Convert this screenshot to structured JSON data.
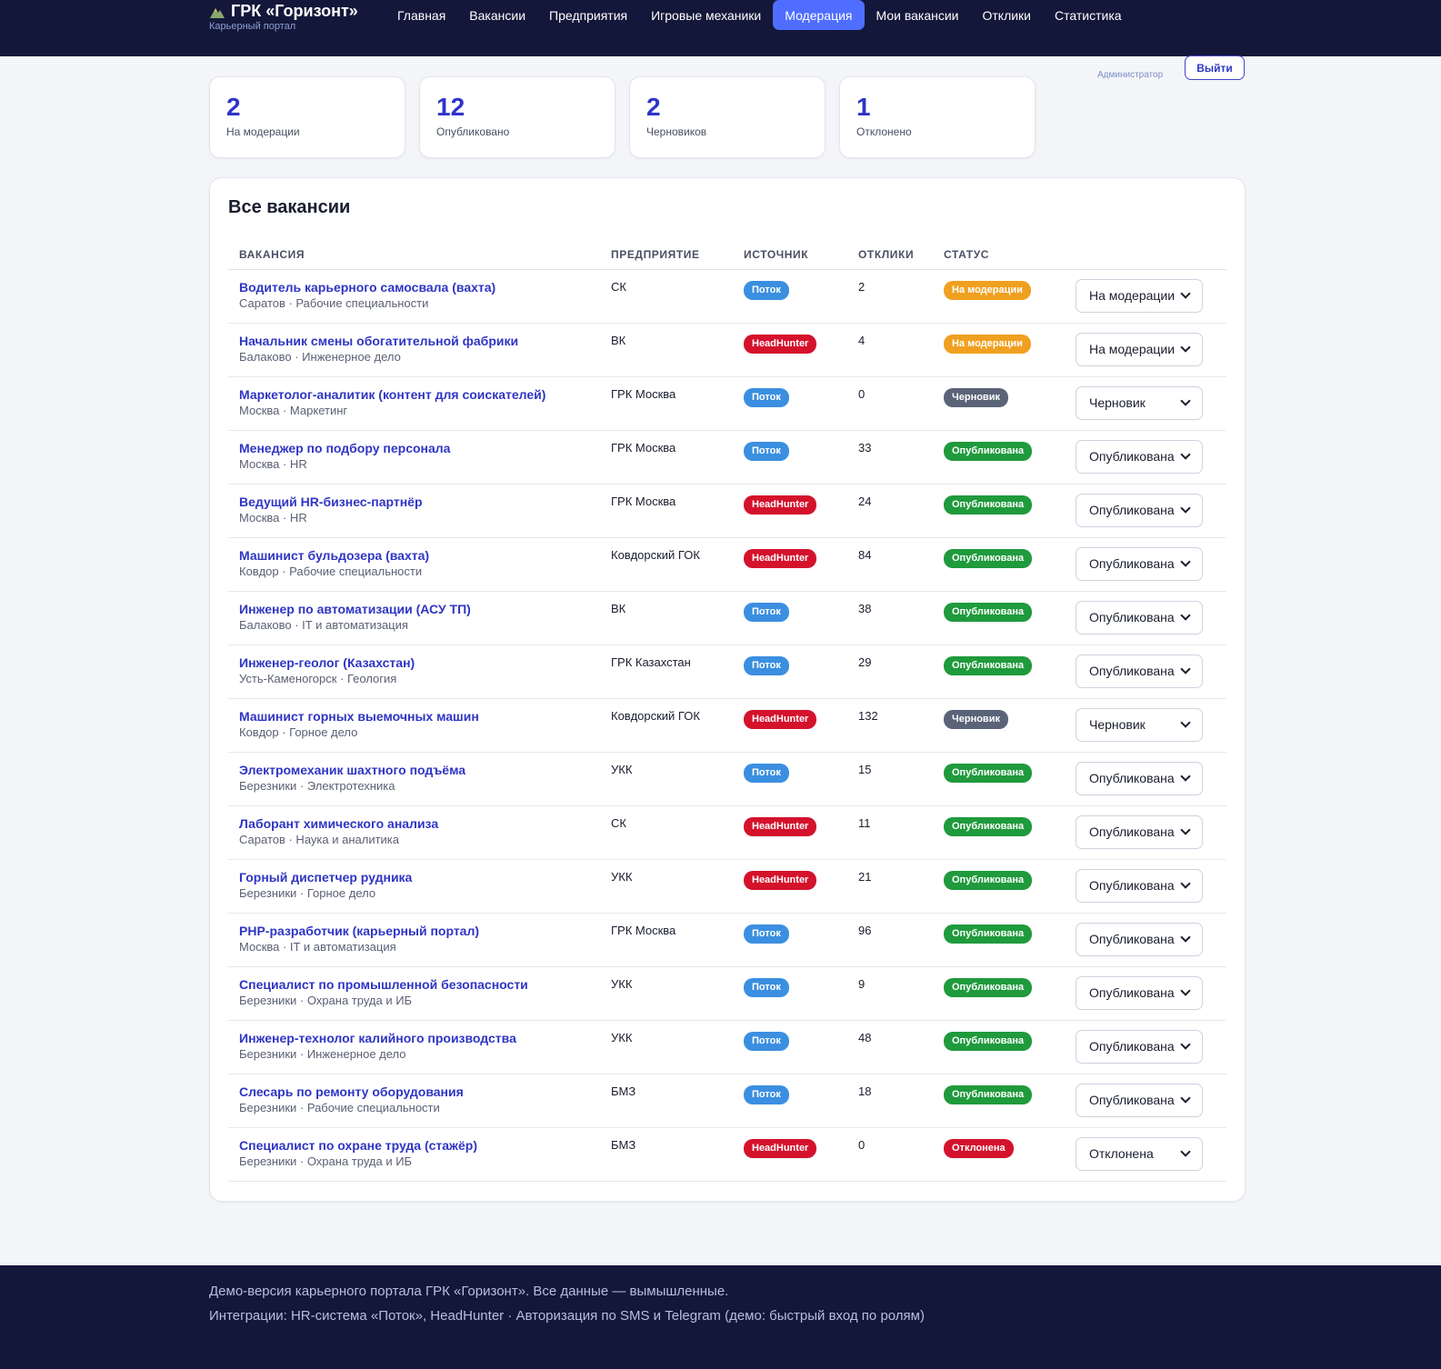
{
  "header": {
    "brand_title": "ГРК «Горизонт»",
    "brand_subtitle": "Карьерный портал",
    "nav": [
      {
        "label": "Главная",
        "active": false
      },
      {
        "label": "Вакансии",
        "active": false
      },
      {
        "label": "Предприятия",
        "active": false
      },
      {
        "label": "Игровые механики",
        "active": false
      },
      {
        "label": "Модерация",
        "active": true
      },
      {
        "label": "Мои вакансии",
        "active": false
      },
      {
        "label": "Отклики",
        "active": false
      },
      {
        "label": "Статистика",
        "active": false
      }
    ],
    "user_role": "Администратор",
    "logout_label": "Выйти"
  },
  "stats": [
    {
      "value": "2",
      "label": "На модерации"
    },
    {
      "value": "12",
      "label": "Опубликовано"
    },
    {
      "value": "2",
      "label": "Черновиков"
    },
    {
      "value": "1",
      "label": "Отклонено"
    }
  ],
  "table": {
    "title": "Все вакансии",
    "columns": [
      "ВАКАНСИЯ",
      "ПРЕДПРИЯТИЕ",
      "ИСТОЧНИК",
      "ОТКЛИКИ",
      "СТАТУС"
    ],
    "rows": [
      {
        "title": "Водитель карьерного самосвала (вахта)",
        "meta": "Саратов · Рабочие специальности",
        "enterprise": "СК",
        "source": "Поток",
        "responses": "2",
        "status": "На модерации",
        "select": "На модерации"
      },
      {
        "title": "Начальник смены обогатительной фабрики",
        "meta": "Балаково · Инженерное дело",
        "enterprise": "ВК",
        "source": "HeadHunter",
        "responses": "4",
        "status": "На модерации",
        "select": "На модерации"
      },
      {
        "title": "Маркетолог-аналитик (контент для соискателей)",
        "meta": "Москва · Маркетинг",
        "enterprise": "ГРК Москва",
        "source": "Поток",
        "responses": "0",
        "status": "Черновик",
        "select": "Черновик"
      },
      {
        "title": "Менеджер по подбору персонала",
        "meta": "Москва · HR",
        "enterprise": "ГРК Москва",
        "source": "Поток",
        "responses": "33",
        "status": "Опубликована",
        "select": "Опубликована"
      },
      {
        "title": "Ведущий HR-бизнес-партнёр",
        "meta": "Москва · HR",
        "enterprise": "ГРК Москва",
        "source": "HeadHunter",
        "responses": "24",
        "status": "Опубликована",
        "select": "Опубликована"
      },
      {
        "title": "Машинист бульдозера (вахта)",
        "meta": "Ковдор · Рабочие специальности",
        "enterprise": "Ковдорский ГОК",
        "source": "HeadHunter",
        "responses": "84",
        "status": "Опубликована",
        "select": "Опубликована"
      },
      {
        "title": "Инженер по автоматизации (АСУ ТП)",
        "meta": "Балаково · IT и автоматизация",
        "enterprise": "ВК",
        "source": "Поток",
        "responses": "38",
        "status": "Опубликована",
        "select": "Опубликована"
      },
      {
        "title": "Инженер-геолог (Казахстан)",
        "meta": "Усть-Каменогорск · Геология",
        "enterprise": "ГРК Казахстан",
        "source": "Поток",
        "responses": "29",
        "status": "Опубликована",
        "select": "Опубликована"
      },
      {
        "title": "Машинист горных выемочных машин",
        "meta": "Ковдор · Горное дело",
        "enterprise": "Ковдорский ГОК",
        "source": "HeadHunter",
        "responses": "132",
        "status": "Черновик",
        "select": "Черновик"
      },
      {
        "title": "Электромеханик шахтного подъёма",
        "meta": "Березники · Электротехника",
        "enterprise": "УКК",
        "source": "Поток",
        "responses": "15",
        "status": "Опубликована",
        "select": "Опубликована"
      },
      {
        "title": "Лаборант химического анализа",
        "meta": "Саратов · Наука и аналитика",
        "enterprise": "СК",
        "source": "HeadHunter",
        "responses": "11",
        "status": "Опубликована",
        "select": "Опубликована"
      },
      {
        "title": "Горный диспетчер рудника",
        "meta": "Березники · Горное дело",
        "enterprise": "УКК",
        "source": "HeadHunter",
        "responses": "21",
        "status": "Опубликована",
        "select": "Опубликована"
      },
      {
        "title": "PHP-разработчик (карьерный портал)",
        "meta": "Москва · IT и автоматизация",
        "enterprise": "ГРК Москва",
        "source": "Поток",
        "responses": "96",
        "status": "Опубликована",
        "select": "Опубликована"
      },
      {
        "title": "Специалист по промышленной безопасности",
        "meta": "Березники · Охрана труда и ИБ",
        "enterprise": "УКК",
        "source": "Поток",
        "responses": "9",
        "status": "Опубликована",
        "select": "Опубликована"
      },
      {
        "title": "Инженер-технолог калийного производства",
        "meta": "Березники · Инженерное дело",
        "enterprise": "УКК",
        "source": "Поток",
        "responses": "48",
        "status": "Опубликована",
        "select": "Опубликована"
      },
      {
        "title": "Слесарь по ремонту оборудования",
        "meta": "Березники · Рабочие специальности",
        "enterprise": "БМЗ",
        "source": "Поток",
        "responses": "18",
        "status": "Опубликована",
        "select": "Опубликована"
      },
      {
        "title": "Специалист по охране труда (стажёр)",
        "meta": "Березники · Охрана труда и ИБ",
        "enterprise": "БМЗ",
        "source": "HeadHunter",
        "responses": "0",
        "status": "Отклонена",
        "select": "Отклонена"
      }
    ]
  },
  "colors": {
    "source": {
      "Поток": "#3b8fe0",
      "HeadHunter": "#d4122c"
    },
    "status": {
      "На модерации": "#f0a020",
      "Черновик": "#5a6378",
      "Опубликована": "#1f9a3c",
      "Отклонена": "#d4122c"
    }
  },
  "footer": {
    "line1": "Демо-версия карьерного портала ГРК «Горизонт». Все данные — вымышленные.",
    "line2": "Интеграции: HR-система «Поток», HeadHunter · Авторизация по SMS и Telegram (демо: быстрый вход по ролям)"
  }
}
